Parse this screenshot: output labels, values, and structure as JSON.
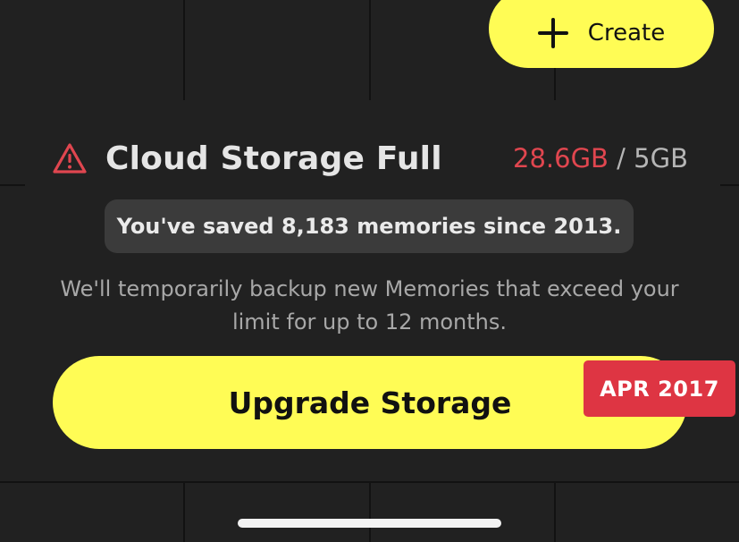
{
  "header": {
    "create_label": "Create"
  },
  "storage": {
    "title": "Cloud Storage Full",
    "used": "28.6GB",
    "separator": " / ",
    "limit": "5GB",
    "saved_message": "You've saved 8,183 memories since 2013.",
    "description": "We'll temporarily backup new Memories that exceed your limit for up to 12 months.",
    "upgrade_label": "Upgrade Storage"
  },
  "date_tag": "APR 2017",
  "colors": {
    "accent_yellow": "#fffc55",
    "warning_red": "#e0464f",
    "date_tag_red": "#de3543",
    "background": "#212121"
  },
  "icons": {
    "create": "plus-icon",
    "warning": "warning-triangle-icon"
  }
}
